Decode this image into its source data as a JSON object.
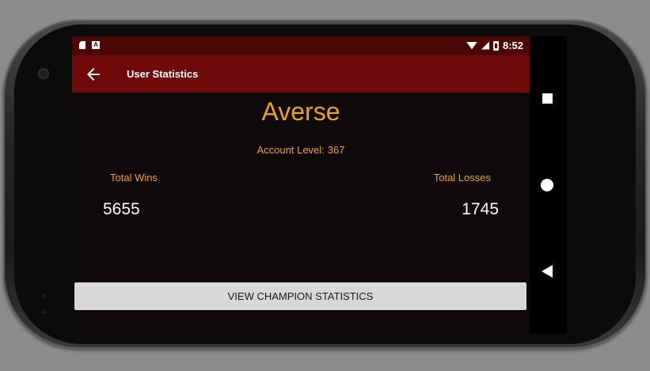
{
  "status_bar": {
    "time": "8:52",
    "icons": [
      "sd-card-icon",
      "a-notification-icon",
      "wifi-icon",
      "signal-icon",
      "battery-icon"
    ]
  },
  "app_bar": {
    "title": "User Statistics",
    "back_icon": "arrow-left-icon"
  },
  "profile": {
    "username": "Averse",
    "account_level_label": "Account Level:",
    "account_level": "367"
  },
  "stats": {
    "wins_label": "Total Wins",
    "wins_value": "5655",
    "losses_label": "Total Losses",
    "losses_value": "1745"
  },
  "actions": {
    "view_champion_label": "VIEW CHAMPION STATISTICS"
  },
  "nav_bar": {
    "icons": [
      "recents-square-icon",
      "home-circle-icon",
      "back-triangle-icon"
    ]
  },
  "colors": {
    "status_bar": "#4c0606",
    "app_bar": "#700909",
    "accent": "#f0a11b",
    "background": "#0e0a0b",
    "button": "#d8d8d8"
  }
}
